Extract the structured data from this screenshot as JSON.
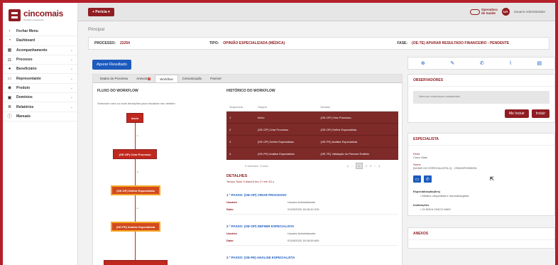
{
  "logo": {
    "name": "cincomais",
    "tagline": "Perícias e Assessoria"
  },
  "sidebar": {
    "items": [
      {
        "label": "Fechar Menu",
        "icon": "chevron-left-icon",
        "glyph": "‹",
        "chevron": ""
      },
      {
        "label": "Dashboard",
        "icon": "dashboard-icon",
        "glyph": "◔",
        "chevron": ""
      },
      {
        "label": "Acompanhamento",
        "icon": "calendar-icon",
        "glyph": "▦",
        "chevron": "⌄"
      },
      {
        "label": "Processo",
        "icon": "scale-icon",
        "glyph": "⚖",
        "chevron": "⌄"
      },
      {
        "label": "Beneficiário",
        "icon": "user-icon",
        "glyph": "●",
        "chevron": "⌄"
      },
      {
        "label": "Representante",
        "icon": "id-card-icon",
        "glyph": "▭",
        "chevron": "⌄"
      },
      {
        "label": "Produto",
        "icon": "product-icon",
        "glyph": "◉",
        "chevron": "⌄"
      },
      {
        "label": "Domínios",
        "icon": "domain-icon",
        "glyph": "▣",
        "chevron": "⌄"
      },
      {
        "label": "Relatórios",
        "icon": "report-icon",
        "glyph": "≣",
        "chevron": "⌄"
      },
      {
        "label": "Manuais",
        "icon": "info-icon",
        "glyph": "ⓘ",
        "chevron": ""
      }
    ]
  },
  "topbar": {
    "pericia_label": "+ Perícia ▾",
    "operator_label": "Operadora\nde Saúde",
    "user_initials": "UA",
    "user_name": "Usuario Administrador"
  },
  "breadcrumb": "Principal",
  "info": {
    "processo_label": "PROCESSO:",
    "processo_value": "22254",
    "tipo_label": "TIPO:",
    "tipo_value": "OPINIÃO ESPECIALIZADA (MÉDICA)",
    "fase_label": "FASE:",
    "fase_value": "(OE-TE) APURAR RESULTADO FINANCEIRO - PENDENTE"
  },
  "apurar_label": "Apurar Resultado",
  "tabs": [
    {
      "label": "Dados do Processo",
      "badge": ""
    },
    {
      "label": "Anexos",
      "badge": "0"
    },
    {
      "label": "Workflow",
      "badge": ""
    },
    {
      "label": "Comunicação",
      "badge": ""
    },
    {
      "label": "Parecer",
      "badge": ""
    }
  ],
  "workflow": {
    "title": "FLUXO DO WORKFLOW",
    "hint": "Selecione uma ou mais transições para visualizar seu detalhe.",
    "nodes": [
      "Início",
      "(OE-OP) Criar Processo",
      "(OE-OP) Definir Especialista",
      "(OE-PE) Análise Especialista"
    ],
    "edge_label": "ok"
  },
  "history": {
    "title": "HISTÓRICO DO WORKFLOW",
    "columns": [
      "Sequencia",
      "Origem",
      "Destino"
    ],
    "rows": [
      [
        "1",
        "Início",
        "(OE-OP) Criar Processo"
      ],
      [
        "2",
        "(OE-OP) Criar Processo",
        "(OE-OP) Definir Especialista"
      ],
      [
        "3",
        "(OE-OP) Definir Especialista",
        "(OE-PE) Análise Especialista"
      ],
      [
        "4",
        "(OE-PE) Análise Especialista",
        "(OE-TE) Validação do Parecer Emitido"
      ]
    ],
    "pager_info": "0 selected / 5 total",
    "pager": [
      "|‹",
      "‹",
      "1",
      "2",
      "3",
      "›",
      "›|"
    ]
  },
  "details": {
    "title": "DETALHES",
    "total_time": "Tempo Total: 0 dias16 hrs 17 min 51 s",
    "steps": [
      {
        "title": "1 º PASSO: (OE-OP) CRIAR PROCESSO",
        "user_label": "Usuário",
        "user": "Usuario Administrador",
        "date_label": "Data:",
        "date": "01/09/2020 18:18:44.315"
      },
      {
        "title": "2 º PASSO: (OE-OP) DEFINIR ESPECIALISTA",
        "user_label": "Usuário",
        "user": "Usuario Administrador",
        "date_label": "Data:",
        "date": "01/09/2020 18:18:59.609"
      },
      {
        "title": "3 º PASSO: (OE-PE) ANÁLISE ESPECIALISTA",
        "user_label": "",
        "user": "",
        "date_label": "",
        "date": ""
      }
    ]
  },
  "actions": [
    "plus-circle-icon",
    "edit-icon",
    "phone-icon",
    "attachment-icon",
    "print-icon"
  ],
  "observers": {
    "title": "OBSERVADORES",
    "empty": "Nenhum observador cadastrado!",
    "me_include": "Me Incluir",
    "include": "Incluir"
  },
  "specialist": {
    "title": "ESPECIALISTA",
    "rede_label": "Rede",
    "rede_value": "Cinco Mais",
    "name_label": "Nome",
    "name_value": "[NOME DO ESPECIALISTA X] - CRM/SP/9999991",
    "specialization_label": "Especialização(ões)",
    "specialization_value": "Médico ortopedista e traumatologista",
    "institution_label": "Instituições",
    "institution_value": "CLÍNICA CINCO MAIS"
  },
  "attachments": {
    "title": "ANEXOS"
  }
}
